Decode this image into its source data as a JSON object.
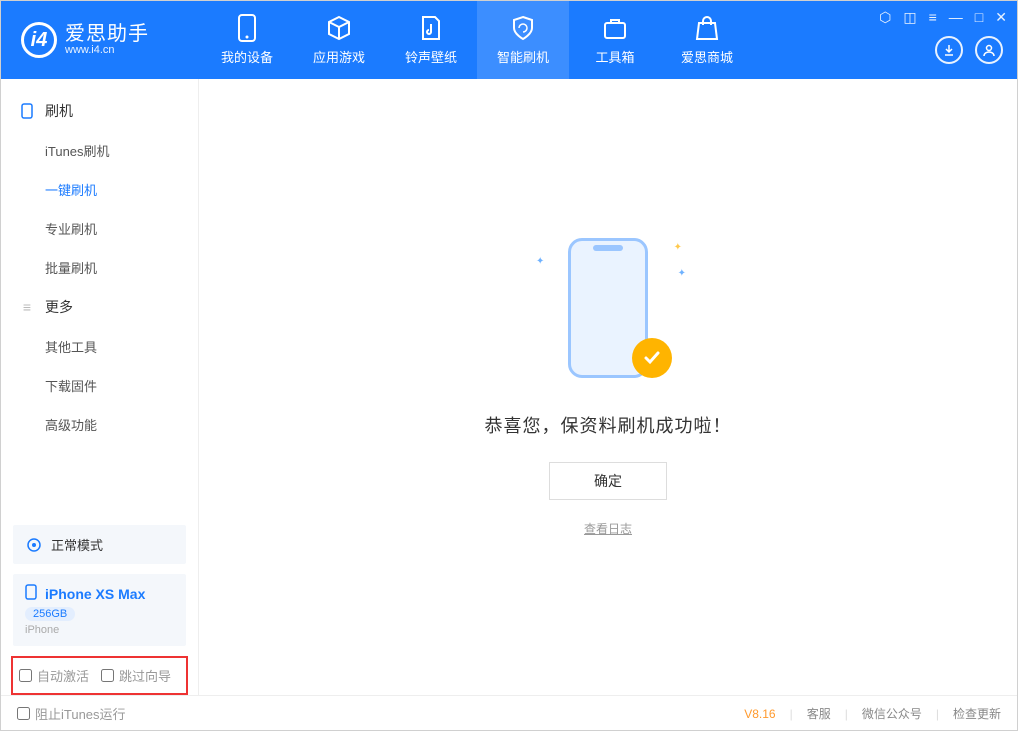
{
  "app": {
    "name_cn": "爱思助手",
    "name_en": "www.i4.cn"
  },
  "nav": {
    "items": [
      {
        "label": "我的设备"
      },
      {
        "label": "应用游戏"
      },
      {
        "label": "铃声壁纸"
      },
      {
        "label": "智能刷机"
      },
      {
        "label": "工具箱"
      },
      {
        "label": "爱思商城"
      }
    ]
  },
  "sidebar": {
    "group1_title": "刷机",
    "group1_items": [
      {
        "label": "iTunes刷机"
      },
      {
        "label": "一键刷机"
      },
      {
        "label": "专业刷机"
      },
      {
        "label": "批量刷机"
      }
    ],
    "group2_title": "更多",
    "group2_items": [
      {
        "label": "其他工具"
      },
      {
        "label": "下载固件"
      },
      {
        "label": "高级功能"
      }
    ],
    "mode_label": "正常模式",
    "device_name": "iPhone XS Max",
    "device_storage": "256GB",
    "device_type": "iPhone",
    "opt_auto_activate": "自动激活",
    "opt_skip_guide": "跳过向导"
  },
  "main": {
    "success_msg": "恭喜您，保资料刷机成功啦！",
    "ok_label": "确定",
    "log_link": "查看日志"
  },
  "status": {
    "block_itunes": "阻止iTunes运行",
    "version": "V8.16",
    "links": [
      "客服",
      "微信公众号",
      "检查更新"
    ]
  }
}
